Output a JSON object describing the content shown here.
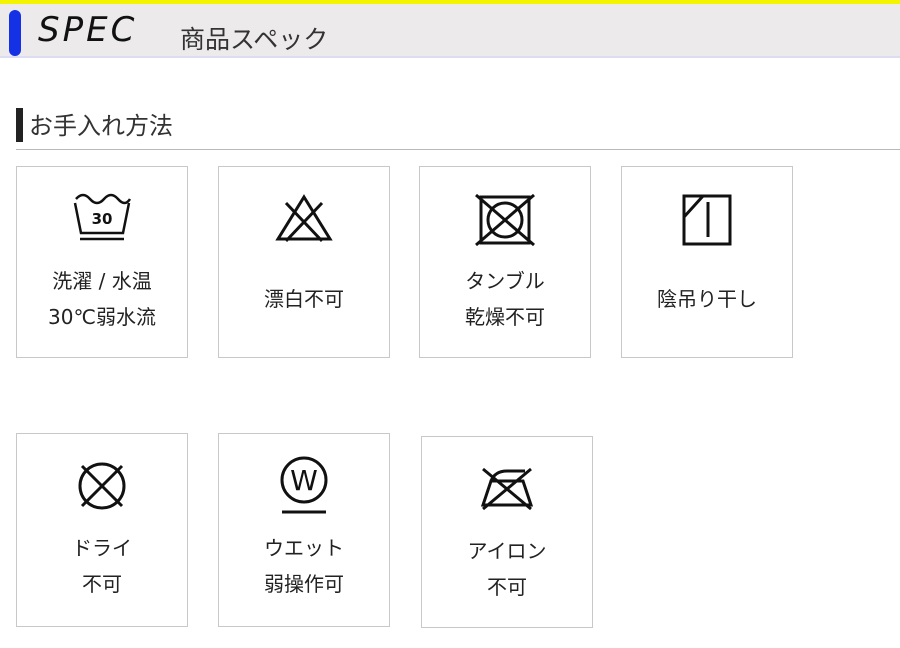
{
  "header": {
    "title": "SPEC",
    "subtitle": "商品スペック"
  },
  "section": {
    "title": "お手入れ方法"
  },
  "care": [
    {
      "icon": "wash-30-tub-icon",
      "lines": [
        "洗濯 / 水温",
        "30℃弱水流"
      ],
      "icon_text": "30"
    },
    {
      "icon": "no-bleach-icon",
      "lines": [
        "漂白不可"
      ]
    },
    {
      "icon": "no-tumble-dry-icon",
      "lines": [
        "タンブル",
        "乾燥不可"
      ]
    },
    {
      "icon": "shade-line-dry-icon",
      "lines": [
        "陰吊り干し"
      ]
    },
    {
      "icon": "no-dry-clean-icon",
      "lines": [
        "ドライ",
        "不可"
      ]
    },
    {
      "icon": "wet-clean-gentle-icon",
      "lines": [
        "ウエット",
        "弱操作可"
      ],
      "icon_text": "W"
    },
    {
      "icon": "no-iron-icon",
      "lines": [
        "アイロン",
        "不可"
      ]
    }
  ]
}
